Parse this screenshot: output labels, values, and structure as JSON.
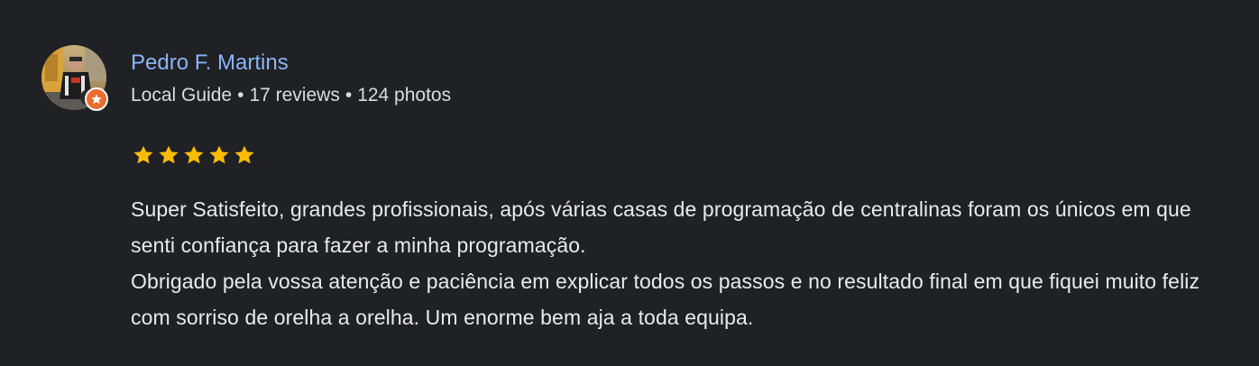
{
  "author": {
    "name": "Pedro F. Martins",
    "badge": "Local Guide",
    "reviews": "17 reviews",
    "photos": "124 photos",
    "separator": "•"
  },
  "rating": {
    "stars": 5,
    "max": 5,
    "color": "#fbbc04"
  },
  "review": {
    "paragraphs": [
      "Super Satisfeito, grandes profissionais, após várias casas de programação de centralinas foram os únicos em que senti confiança para fazer a minha programação.",
      "Obrigado pela vossa atenção e paciência em explicar todos os passos e no resultado final em que fiquei muito feliz com sorriso de orelha a orelha. Um enorme bem aja a toda equipa."
    ]
  },
  "colors": {
    "background": "#202124",
    "name": "#8ab4f8",
    "text": "#e8eaed",
    "guide_badge": "#ea6c30"
  },
  "icons": {
    "avatar": "avatar-photo",
    "guide_badge": "local-guide-star-icon",
    "rating": "star-icon"
  }
}
